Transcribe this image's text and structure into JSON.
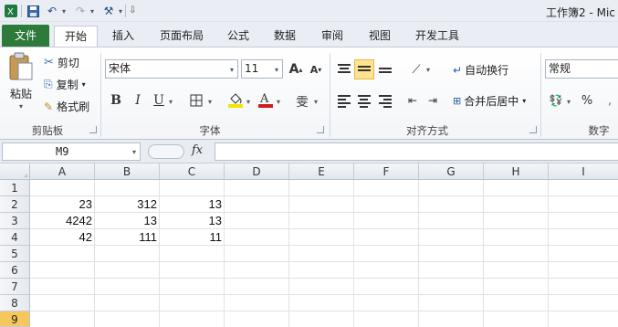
{
  "window": {
    "title": "工作簿2 - Mic"
  },
  "qat": {
    "save_icon": "save-icon",
    "undo_icon": "undo-icon",
    "redo_icon": "redo-icon",
    "customize_icon": "customize-icon"
  },
  "tabs": [
    "文件",
    "开始",
    "插入",
    "页面布局",
    "公式",
    "数据",
    "审阅",
    "视图",
    "开发工具"
  ],
  "active_tab": "开始",
  "ribbon": {
    "clipboard": {
      "paste": "粘贴",
      "cut": "剪切",
      "copy": "复制",
      "format_painter": "格式刷",
      "label": "剪贴板"
    },
    "font": {
      "name": "宋体",
      "size": "11",
      "label": "字体",
      "bold": "B",
      "italic": "I",
      "underline": "U",
      "grow": "A",
      "shrink": "A",
      "color_a": "A",
      "phonetic": "雯"
    },
    "alignment": {
      "wrap": "自动换行",
      "merge": "合并后居中",
      "label": "对齐方式"
    },
    "number": {
      "format": "常规",
      "percent": "%",
      "label": "数字"
    }
  },
  "formula_bar": {
    "name_box": "M9",
    "fx": "fx",
    "value": ""
  },
  "columns": [
    "A",
    "B",
    "C",
    "D",
    "E",
    "F",
    "G",
    "H",
    "I"
  ],
  "rows": [
    "1",
    "2",
    "3",
    "4",
    "5",
    "6",
    "7",
    "8",
    "9"
  ],
  "selected_row": "9",
  "cells": {
    "r2": [
      "23",
      "312",
      "13"
    ],
    "r3": [
      "4242",
      "13",
      "13"
    ],
    "r4": [
      "42",
      "111",
      "11"
    ]
  },
  "colors": {
    "file_tab": "#2e7a3a",
    "selected_align": "#fde38f",
    "row_highlight": "#f6c75a"
  }
}
